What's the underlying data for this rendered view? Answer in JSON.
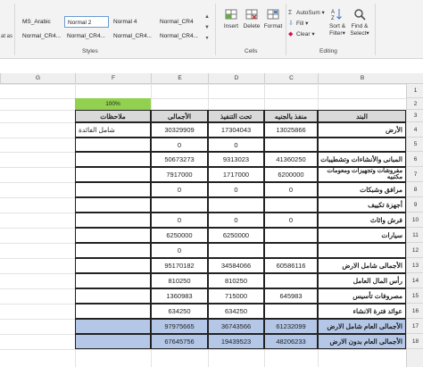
{
  "ribbon": {
    "left_partial_label": "at as",
    "styles": {
      "row1": [
        "MS_Arabic",
        "Normal 2",
        "Normal 4",
        "Normal_CR4"
      ],
      "row2": [
        "Normal_CR4...",
        "Normal_CR4...",
        "Normal_CR4...",
        "Normal_CR4..."
      ],
      "group_label": "Styles"
    },
    "cells": {
      "insert": "Insert",
      "delete": "Delete",
      "format": "Format",
      "group_label": "Cells"
    },
    "editing": {
      "autosum": "AutoSum",
      "fill": "Fill",
      "clear": "Clear",
      "sort_filter": "Sort &",
      "sort_filter2": "Filter",
      "find_select": "Find &",
      "find_select2": "Select",
      "group_label": "Editing"
    }
  },
  "columns": [
    "G",
    "F",
    "E",
    "D",
    "C",
    "B"
  ],
  "rows": [
    "1",
    "2",
    "3",
    "4",
    "5",
    "6",
    "7",
    "8",
    "9",
    "10",
    "11",
    "12",
    "13",
    "14",
    "15",
    "16",
    "17",
    "18"
  ],
  "percent_cell": "100%",
  "table": {
    "headers": {
      "notes": "ملاحظات",
      "total": "الأجمالى",
      "under_exec": "تحت التنفيذ",
      "implemented": "منفذ بالجنيه",
      "item": "البند"
    },
    "rows": [
      {
        "notes": "شامل الفائدة",
        "total": "30329909",
        "under_exec": "17304043",
        "implemented": "13025866",
        "item": "الأرض"
      },
      {
        "notes": "",
        "total": "0",
        "under_exec": "0",
        "implemented": "",
        "item": ""
      },
      {
        "notes": "",
        "total": "50673273",
        "under_exec": "9313023",
        "implemented": "41360250",
        "item": "المبانى والأنشاءات وتشطيبات"
      },
      {
        "notes": "",
        "total": "7917000",
        "under_exec": "1717000",
        "implemented": "6200000",
        "item": "مفروشات وتجهيزات ومعومات مكتبيه"
      },
      {
        "notes": "",
        "total": "0",
        "under_exec": "0",
        "implemented": "0",
        "item": "مرافق وشبكات"
      },
      {
        "notes": "",
        "total": "",
        "under_exec": "",
        "implemented": "",
        "item": "أجهزة تكييف"
      },
      {
        "notes": "",
        "total": "0",
        "under_exec": "0",
        "implemented": "0",
        "item": "فرش واثاث"
      },
      {
        "notes": "",
        "total": "6250000",
        "under_exec": "6250000",
        "implemented": "",
        "item": "سيارات"
      },
      {
        "notes": "",
        "total": "0",
        "under_exec": "",
        "implemented": "",
        "item": ""
      },
      {
        "notes": "",
        "total": "95170182",
        "under_exec": "34584066",
        "implemented": "60586116",
        "item": "الأجمالى شامل الارض"
      },
      {
        "notes": "",
        "total": "810250",
        "under_exec": "810250",
        "implemented": "",
        "item": "رأس المال العامل"
      },
      {
        "notes": "",
        "total": "1360983",
        "under_exec": "715000",
        "implemented": "645983",
        "item": "مصروفات تأسيس"
      },
      {
        "notes": "",
        "total": "634250",
        "under_exec": "634250",
        "implemented": "",
        "item": "عوائد فترة الانشاء"
      },
      {
        "notes": "",
        "total": "97975665",
        "under_exec": "36743566",
        "implemented": "61232099",
        "item": "الأجمالى العام شامل الارض"
      },
      {
        "notes": "",
        "total": "67645756",
        "under_exec": "19439523",
        "implemented": "48206233",
        "item": "الأجمالى العام بدون الارض"
      }
    ]
  },
  "colors": {
    "header_fill": "#d9d9d9",
    "total_fill": "#b4c7e7",
    "percent_fill": "#92d050"
  }
}
